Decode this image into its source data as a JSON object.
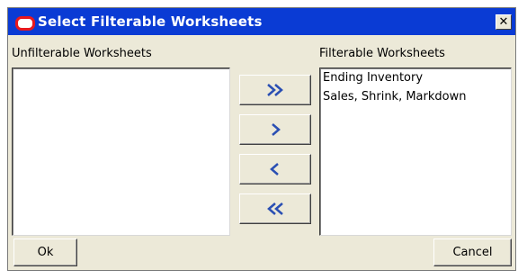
{
  "window": {
    "title": "Select Filterable Worksheets",
    "close_glyph": "✕"
  },
  "left_panel": {
    "label": "Unfilterable Worksheets",
    "items": []
  },
  "right_panel": {
    "label": "Filterable Worksheets",
    "items": [
      "Ending Inventory",
      "Sales, Shrink, Markdown"
    ]
  },
  "transfer_buttons": [
    {
      "name": "move-all-right",
      "icon": "double-chevron-right-icon"
    },
    {
      "name": "move-right",
      "icon": "chevron-right-icon"
    },
    {
      "name": "move-left",
      "icon": "chevron-left-icon"
    },
    {
      "name": "move-all-left",
      "icon": "double-chevron-left-icon"
    }
  ],
  "footer": {
    "ok_label": "Ok",
    "cancel_label": "Cancel"
  },
  "colors": {
    "titlebar": "#0a3bd4",
    "dialog_bg": "#ece9d8",
    "logo": "#e8181e",
    "arrow_blue": "#2a4fb3"
  }
}
